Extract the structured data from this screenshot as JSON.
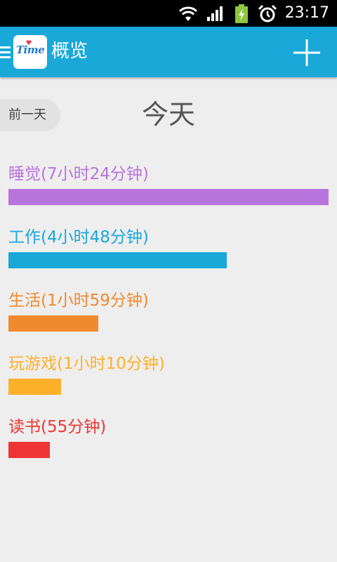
{
  "status_bar": {
    "time": "23:17",
    "icons": [
      "wifi-icon",
      "signal-icon",
      "battery-charging-icon",
      "alarm-icon"
    ]
  },
  "action_bar": {
    "logo_text": "Time",
    "title": "概览",
    "add_icon": "plus-icon",
    "menu_icon": "menu-icon"
  },
  "day_nav": {
    "prev_label": "前一天",
    "current": "今天"
  },
  "activities": [
    {
      "label": "睡觉(7小时24分钟)",
      "color": "#b874dd",
      "fraction": 1.0
    },
    {
      "label": "工作(4小时48分钟)",
      "color": "#1aa8d9",
      "fraction": 0.6818
    },
    {
      "label": "生活(1小时59分钟)",
      "color": "#f08a2f",
      "fraction": 0.2815
    },
    {
      "label": "玩游戏(1小时10分钟)",
      "color": "#fdb12b",
      "fraction": 0.1645
    },
    {
      "label": "读书(55分钟)",
      "color": "#ef3434",
      "fraction": 0.1294
    }
  ]
}
